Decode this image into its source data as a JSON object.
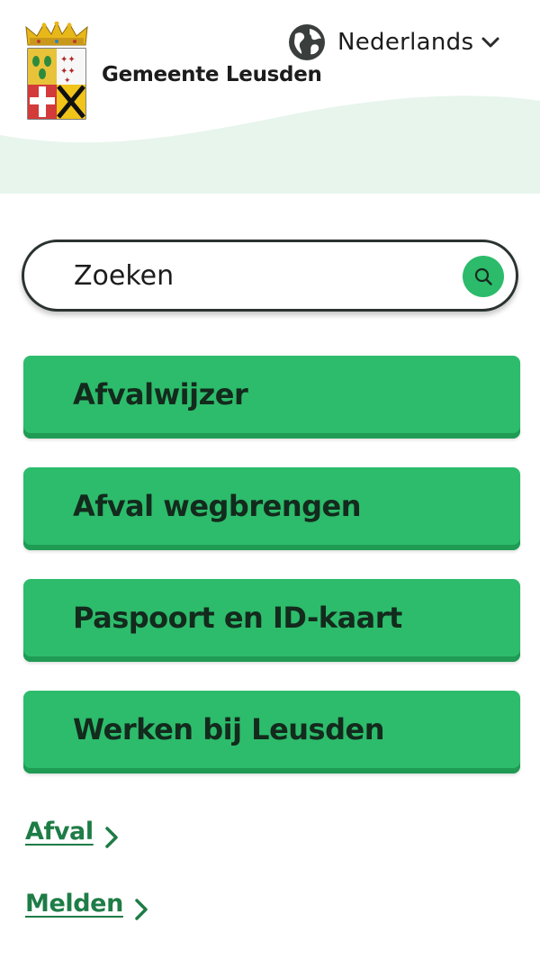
{
  "header": {
    "site_title": "Gemeente Leusden",
    "language": {
      "label": "Nederlands",
      "icon": "globe-icon",
      "chevron_icon": "chevron-down-icon"
    },
    "logo": {
      "icon": "coat-of-arms-logo"
    }
  },
  "search": {
    "placeholder": "Zoeken",
    "value": "",
    "button_icon": "search-icon"
  },
  "tiles": [
    {
      "label": "Afvalwijzer"
    },
    {
      "label": "Afval wegbrengen"
    },
    {
      "label": "Paspoort en ID-kaart"
    },
    {
      "label": "Werken bij Leusden"
    }
  ],
  "links": [
    {
      "label": "Afval",
      "icon": "chevron-right-icon"
    },
    {
      "label": "Melden",
      "icon": "chevron-right-icon"
    }
  ],
  "colors": {
    "accent_green": "#2dbc6b",
    "link_green": "#1e7c46",
    "wave_tint": "#e7f5ec",
    "search_border": "#2b3331"
  }
}
